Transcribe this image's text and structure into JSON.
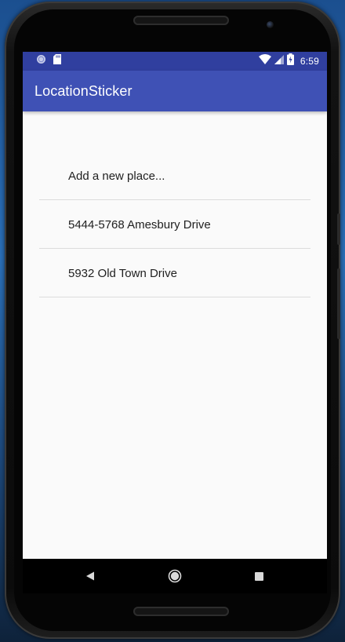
{
  "status_bar": {
    "time": "6:59",
    "left_icons": [
      "sync-icon",
      "sd-card-icon"
    ],
    "right_icons": [
      "wifi-icon",
      "cell-signal-icon",
      "battery-charging-icon"
    ]
  },
  "app_bar": {
    "title": "LocationSticker"
  },
  "places": [
    {
      "label": "Add a new place..."
    },
    {
      "label": "5444-5768 Amesbury Drive"
    },
    {
      "label": "5932 Old Town Drive"
    }
  ],
  "nav_bar": {
    "buttons": [
      "back-icon",
      "home-icon",
      "recents-icon"
    ]
  },
  "colors": {
    "status_bar": "#303f9f",
    "app_bar": "#3f51b5",
    "background": "#fafafa",
    "text": "#212121",
    "divider": "#dcdcdc"
  }
}
